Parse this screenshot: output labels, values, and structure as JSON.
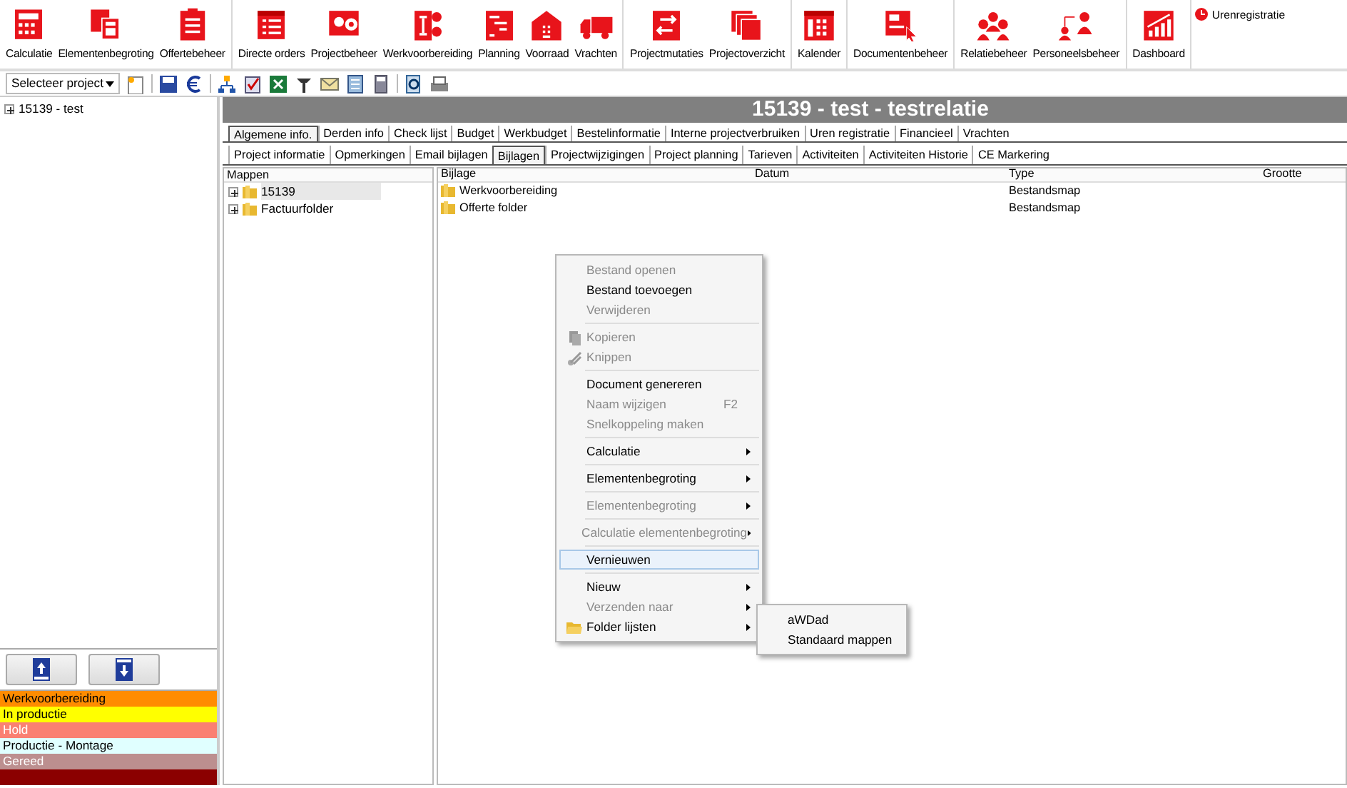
{
  "ribbon": {
    "groups": [
      {
        "items": [
          "Calculatie",
          "Elementenbegroting",
          "Offertebeheer"
        ]
      },
      {
        "items": [
          "Directe orders",
          "Projectbeheer",
          "Werkvoorbereiding",
          "Planning",
          "Voorraad",
          "Vrachten"
        ]
      },
      {
        "items": [
          "Projectmutaties",
          "Projectoverzicht"
        ]
      },
      {
        "items": [
          "Kalender"
        ]
      },
      {
        "items": [
          "Documentenbeheer"
        ]
      },
      {
        "items": [
          "Relatiebeheer",
          "Personeelsbeheer"
        ]
      },
      {
        "items": [
          "Dashboard"
        ]
      }
    ],
    "side_link": "Urenregistratie"
  },
  "toolbar": {
    "project_select": {
      "value": "Selecteer project"
    }
  },
  "project_tree": [
    {
      "label": "15139 - test",
      "expanded": false
    }
  ],
  "status_legend": [
    {
      "label": "Werkvoorbereiding",
      "color": "#ff8c00",
      "dimmed": false
    },
    {
      "label": "In productie",
      "color": "#ffff00",
      "dimmed": false
    },
    {
      "label": "Hold",
      "color": "#fa8072",
      "dimmed": true
    },
    {
      "label": "Productie - Montage",
      "color": "#e0ffff",
      "dimmed": false
    },
    {
      "label": "Gereed",
      "color": "#bc8f8f",
      "dimmed": true
    },
    {
      "color": "#8b0000"
    }
  ],
  "title": "15139 - test - testrelatie",
  "tabs": [
    {
      "label": "Algemene info.",
      "selected": true
    },
    {
      "label": "Derden info",
      "selected": false
    },
    {
      "label": "Check lijst",
      "selected": false
    },
    {
      "label": "Budget",
      "selected": false
    },
    {
      "label": "Werkbudget",
      "selected": false
    },
    {
      "label": "Bestelinformatie",
      "selected": false
    },
    {
      "label": "Interne projectverbruiken",
      "selected": false
    },
    {
      "label": "Uren registratie",
      "selected": false
    },
    {
      "label": "Financieel",
      "selected": false
    },
    {
      "label": "Vrachten",
      "selected": false
    }
  ],
  "subtabs": [
    {
      "label": "Project informatie",
      "selected": false
    },
    {
      "label": "Opmerkingen",
      "selected": false
    },
    {
      "label": "Email bijlagen",
      "selected": false
    },
    {
      "label": "Bijlagen",
      "selected": true
    },
    {
      "label": "Projectwijzigingen",
      "selected": false
    },
    {
      "label": "Project planning",
      "selected": false
    },
    {
      "label": "Tarieven",
      "selected": false
    },
    {
      "label": "Activiteiten",
      "selected": false
    },
    {
      "label": "Activiteiten Historie",
      "selected": false
    },
    {
      "label": "CE Markering",
      "selected": false
    }
  ],
  "folders": {
    "header": "Mappen",
    "items": [
      {
        "label": "15139",
        "selected": true,
        "expanded": false
      },
      {
        "label": "Factuurfolder",
        "selected": false,
        "expanded": false
      }
    ]
  },
  "files": {
    "columns": [
      "Bijlage",
      "Datum",
      "Type",
      "Grootte"
    ],
    "rows": [
      [
        "Werkvoorbereiding",
        "",
        "Bestandsmap",
        ""
      ],
      [
        "Offerte folder",
        "",
        "Bestandsmap",
        ""
      ]
    ]
  },
  "context_menu": [
    {
      "kind": "item",
      "label": "Bestand openen",
      "disabled": true
    },
    {
      "kind": "item",
      "label": "Bestand toevoegen",
      "disabled": false
    },
    {
      "kind": "item",
      "label": "Verwijderen",
      "disabled": true
    },
    {
      "kind": "separator"
    },
    {
      "kind": "item",
      "label": "Kopieren",
      "disabled": true
    },
    {
      "kind": "item",
      "label": "Knippen",
      "disabled": true
    },
    {
      "kind": "separator"
    },
    {
      "kind": "item",
      "label": "Document genereren",
      "disabled": false
    },
    {
      "kind": "item",
      "label": "Naam wijzigen",
      "disabled": true,
      "shortcut": "F2"
    },
    {
      "kind": "item",
      "label": "Snelkoppeling maken",
      "disabled": true
    },
    {
      "kind": "separator"
    },
    {
      "kind": "item",
      "label": "Calculatie",
      "disabled": false,
      "submenu": true
    },
    {
      "kind": "separator"
    },
    {
      "kind": "item",
      "label": "Elementenbegroting",
      "disabled": false,
      "submenu": true
    },
    {
      "kind": "separator"
    },
    {
      "kind": "item",
      "label": "Elementenbegroting",
      "disabled": true,
      "submenu": true
    },
    {
      "kind": "separator"
    },
    {
      "kind": "item",
      "label": "Calculatie elementenbegroting",
      "disabled": true,
      "submenu": true
    },
    {
      "kind": "separator"
    },
    {
      "kind": "item",
      "label": "Vernieuwen",
      "disabled": false,
      "selected": true
    },
    {
      "kind": "separator"
    },
    {
      "kind": "item",
      "label": "Nieuw",
      "disabled": false,
      "submenu": true
    },
    {
      "kind": "item",
      "label": "Verzenden naar",
      "disabled": true,
      "submenu": true
    },
    {
      "kind": "item",
      "label": "Folder lijsten",
      "disabled": false,
      "submenu": true,
      "expanded": true
    }
  ],
  "submenu": [
    "aWDad",
    "Standaard mappen"
  ]
}
